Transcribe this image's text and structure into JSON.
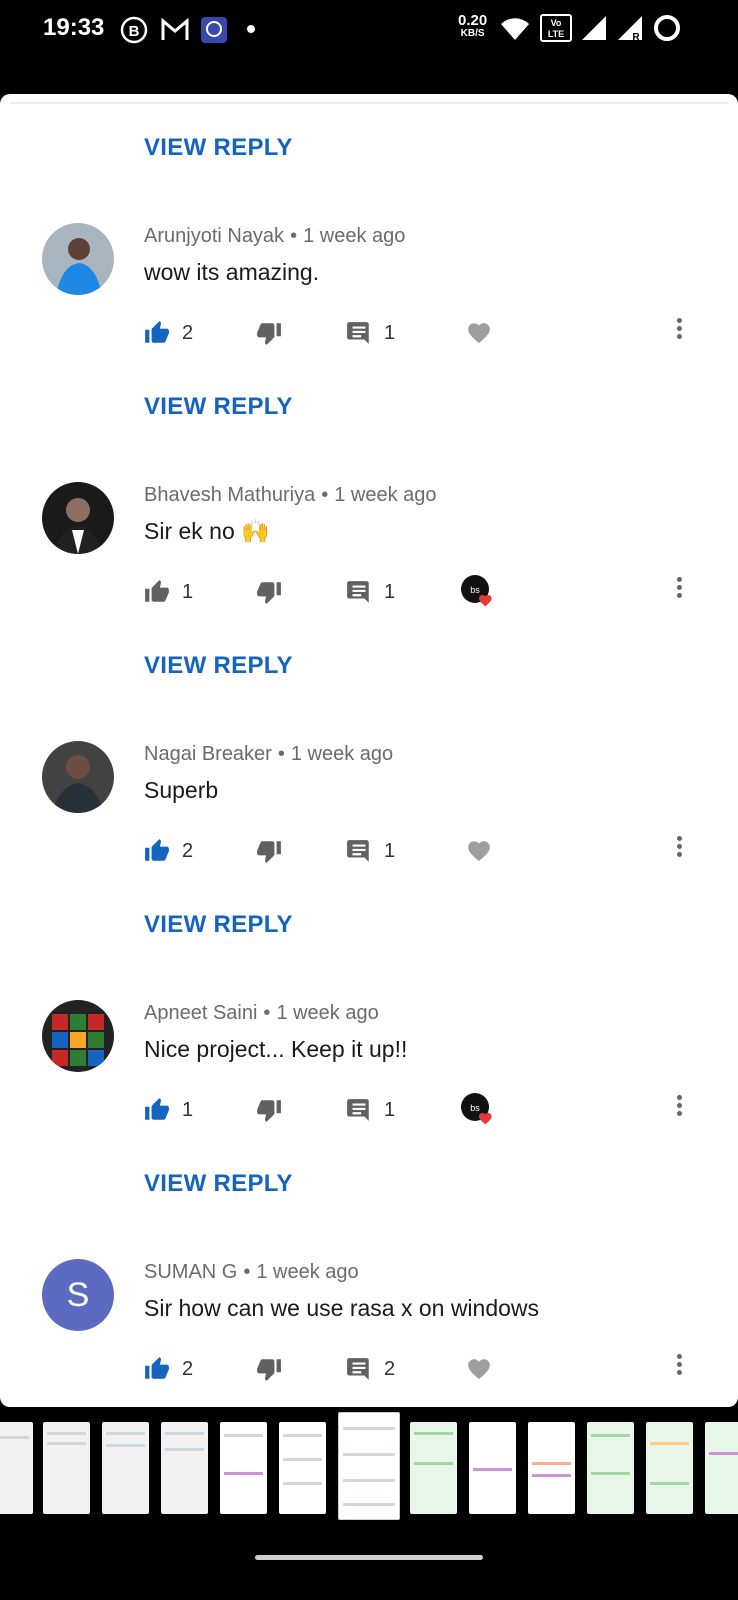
{
  "status_bar": {
    "time": "19:33",
    "net_speed": "0.20",
    "net_unit": "KB/S",
    "volte_label": "Vo LTE 2",
    "roaming": "R"
  },
  "comments": [
    {
      "author": "Arunjyoti Nayak",
      "time": "1 week ago",
      "text": "wow its amazing.",
      "likes": "2",
      "liked": true,
      "replies": "1",
      "creator_heart": false,
      "avatar_icon": "person-photo"
    },
    {
      "author": "Bhavesh Mathuriya",
      "time": "1 week ago",
      "text": "Sir ek no 🙌",
      "likes": "1",
      "liked": false,
      "replies": "1",
      "creator_heart": true,
      "avatar_icon": "person-photo"
    },
    {
      "author": "Nagai Breaker",
      "time": "1 week ago",
      "text": "Superb",
      "likes": "2",
      "liked": true,
      "replies": "1",
      "creator_heart": false,
      "avatar_icon": "person-photo"
    },
    {
      "author": "Apneet Saini",
      "time": "1 week ago",
      "text": "Nice project... Keep it up!!",
      "likes": "1",
      "liked": true,
      "replies": "1",
      "creator_heart": true,
      "avatar_icon": "rubiks-cube-photo"
    },
    {
      "author": "SUMAN G",
      "time": "1 week ago",
      "text": "Sir how can we use rasa x on windows",
      "likes": "2",
      "liked": true,
      "replies": "2",
      "creator_heart": false,
      "avatar_letter": "S"
    }
  ],
  "view_reply_label": "VIEW REPLY",
  "colors": {
    "accent_blue": "#1565c0",
    "like_active": "#1565c0",
    "icon_gray": "#616161",
    "heart_gray": "#9e9e9e",
    "heart_red": "#e53935",
    "suman_avatar": "#5c6bc0"
  }
}
